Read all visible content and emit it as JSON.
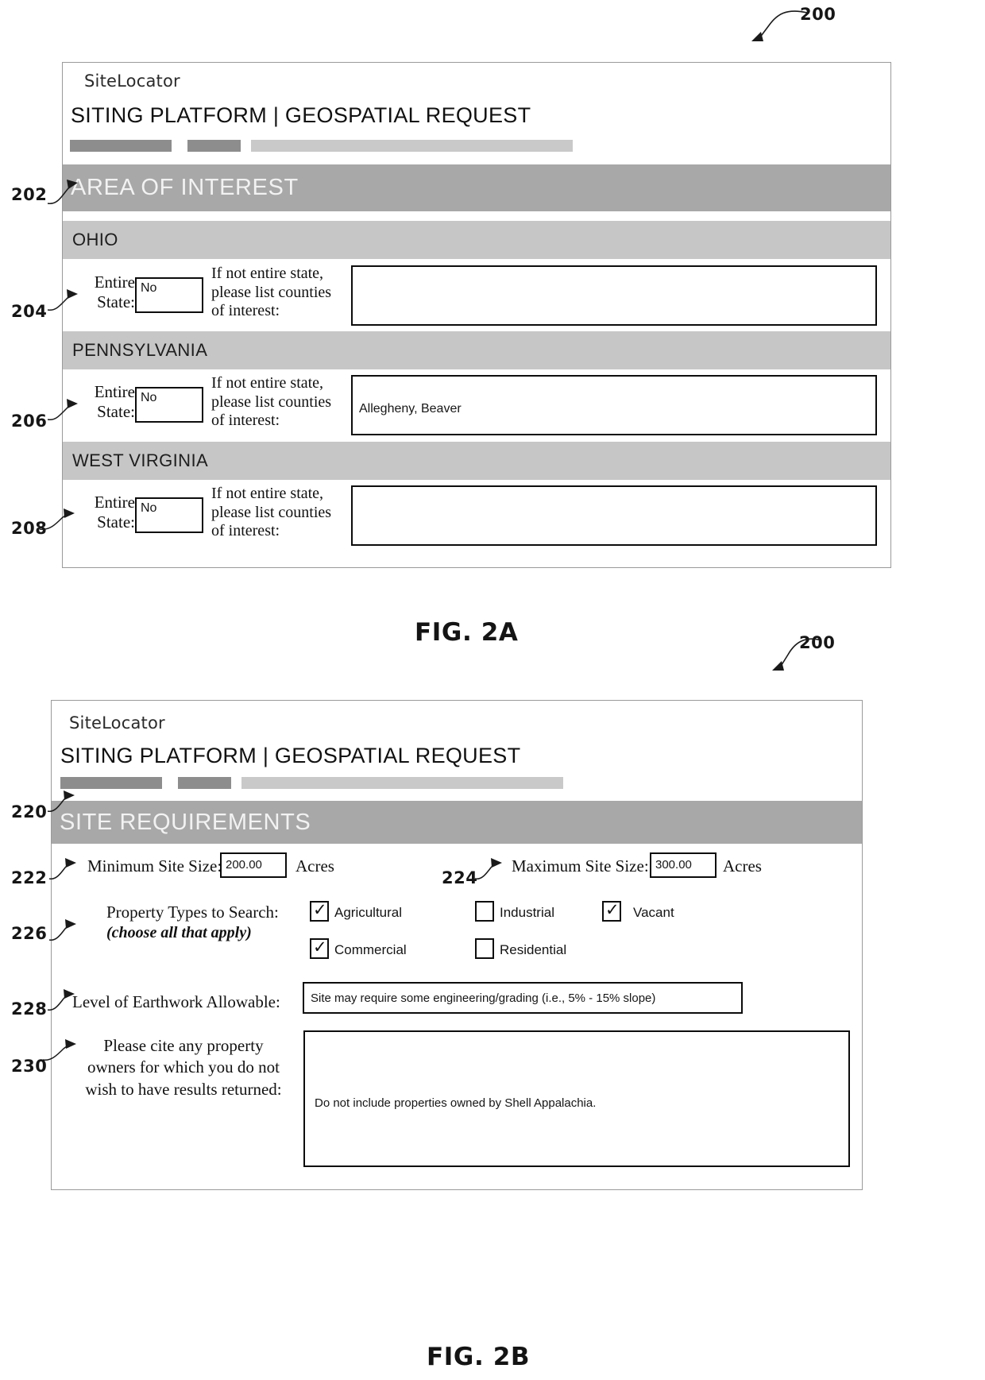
{
  "figures": [
    {
      "ref": "200",
      "caption": "FIG. 2A",
      "app": {
        "brand": "SiteLocator",
        "title": "SITING PLATFORM | GEOSPATIAL REQUEST"
      },
      "section": {
        "ref": "202",
        "label": "AREA OF INTEREST"
      },
      "states": [
        {
          "ref": "204",
          "name": "OHIO",
          "entire_state_label_line1": "Entire",
          "entire_state_label_line2": "State:",
          "entire_state_value": "No",
          "counties_label_line1": "If not entire state,",
          "counties_label_line2": "please list counties",
          "counties_label_line3": "of interest:",
          "counties_value": ""
        },
        {
          "ref": "206",
          "name": "PENNSYLVANIA",
          "entire_state_label_line1": "Entire",
          "entire_state_label_line2": "State:",
          "entire_state_value": "No",
          "counties_label_line1": "If not entire state,",
          "counties_label_line2": "please list counties",
          "counties_label_line3": "of interest:",
          "counties_value": "Allegheny, Beaver"
        },
        {
          "ref": "208",
          "name": "WEST VIRGINIA",
          "entire_state_label_line1": "Entire",
          "entire_state_label_line2": "State:",
          "entire_state_value": "No",
          "counties_label_line1": "If not entire state,",
          "counties_label_line2": "please list counties",
          "counties_label_line3": "of interest:",
          "counties_value": ""
        }
      ]
    },
    {
      "ref": "200",
      "caption": "FIG. 2B",
      "app": {
        "brand": "SiteLocator",
        "title": "SITING PLATFORM | GEOSPATIAL REQUEST"
      },
      "section": {
        "ref": "220",
        "label": "SITE REQUIREMENTS"
      },
      "min_site": {
        "ref": "222",
        "label": "Minimum Site Size:",
        "value": "200.00",
        "unit": "Acres"
      },
      "max_site": {
        "ref": "224",
        "label": "Maximum Site Size:",
        "value": "300.00",
        "unit": "Acres"
      },
      "property_types": {
        "ref": "226",
        "label": "Property Types to Search:",
        "sublabel": "(choose all that apply)",
        "options": [
          {
            "label": "Agricultural",
            "checked": true
          },
          {
            "label": "Industrial",
            "checked": false
          },
          {
            "label": "Vacant",
            "checked": true
          },
          {
            "label": "Commercial",
            "checked": true
          },
          {
            "label": "Residential",
            "checked": false
          }
        ]
      },
      "earthwork": {
        "ref": "228",
        "label": "Level of Earthwork Allowable:",
        "value": "Site may require some engineering/grading (i.e., 5% - 15% slope)"
      },
      "exclusions": {
        "ref": "230",
        "label_line1": "Please cite any property",
        "label_line2": "owners for which you do not",
        "label_line3": "wish to have results returned:",
        "value": "Do not include properties owned by Shell Appalachia."
      }
    }
  ],
  "colors": {
    "section_bar": "#a8a8a8",
    "state_bar": "#c6c6c6",
    "nav_chip_dark": "#8d8d8d",
    "nav_chip_light": "#c9c9c9",
    "frame_border": "#9a9a9a",
    "field_border": "#0c0c0c"
  }
}
